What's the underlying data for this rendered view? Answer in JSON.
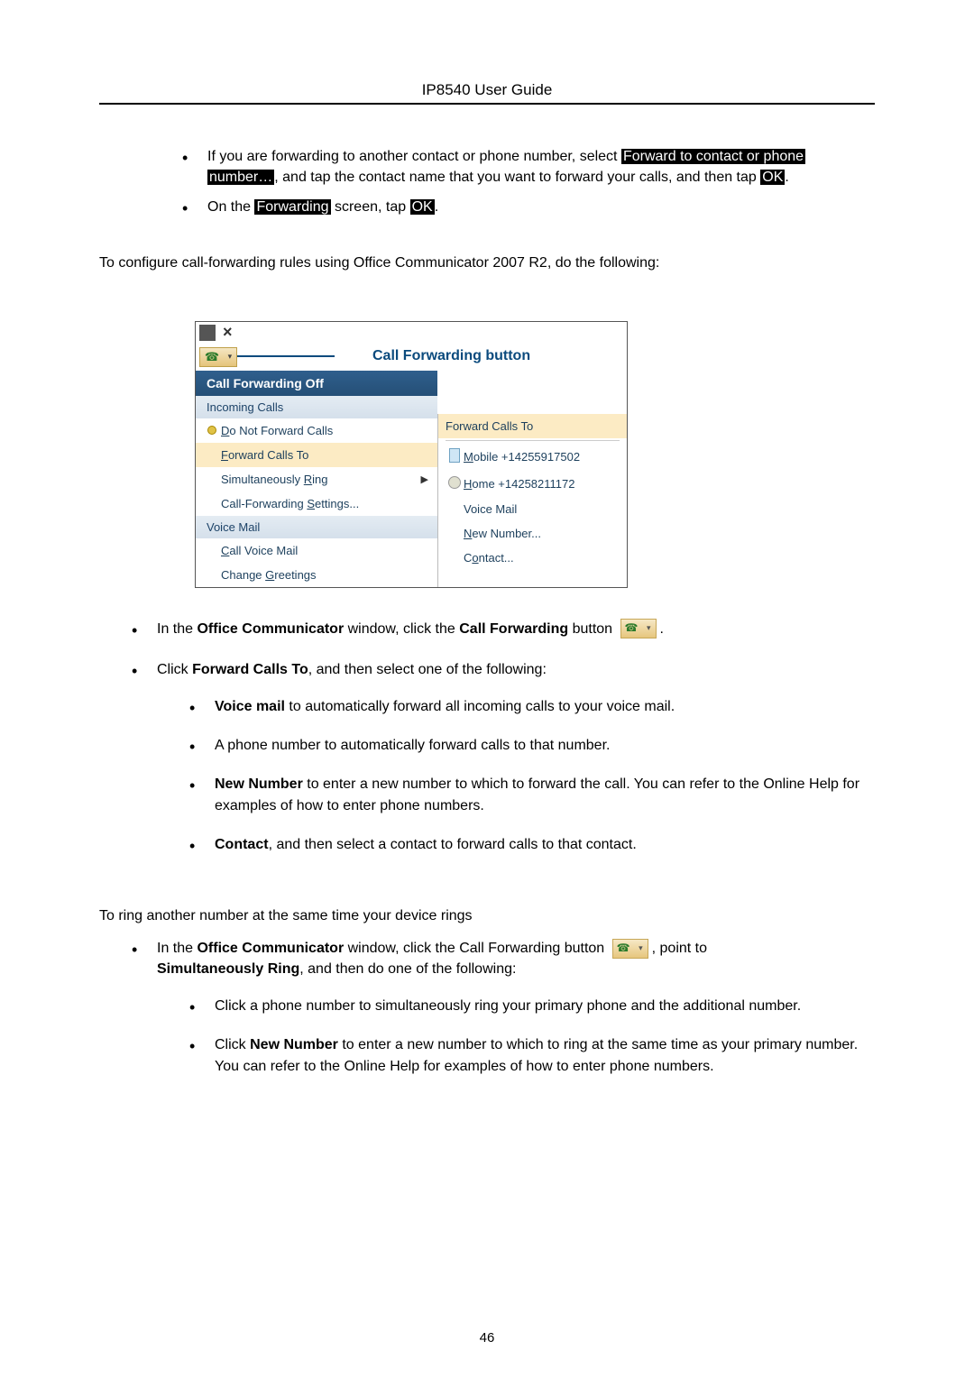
{
  "header": {
    "title": "IP8540 User Guide"
  },
  "bullets_top": [
    {
      "pre": "If you are forwarding to another contact or phone number, select ",
      "hl1": "Forward to contact or phone",
      "br": true,
      "hl1b": "number…",
      "mid": ", and tap the contact name that you want to forward your calls, and then tap ",
      "hl2": "OK",
      "suffix": "."
    },
    {
      "pre": "On the ",
      "hl1": "Forwarding",
      "mid": " screen, tap ",
      "hl2": "OK",
      "suffix": "."
    }
  ],
  "configure_line": "To configure call-forwarding rules using Office Communicator 2007 R2, do the following:",
  "menu": {
    "label": "Call Forwarding button",
    "left": {
      "header": "Call Forwarding Off",
      "section1": "Incoming Calls",
      "items1": [
        {
          "icon": "radio",
          "text": "Do Not Forward Calls",
          "u": "D"
        },
        {
          "text": "Forward Calls To",
          "u": "F",
          "selected": true
        },
        {
          "text": "Simultaneously Ring",
          "u": "R",
          "chev": true
        },
        {
          "text": "Call-Forwarding Settings...",
          "u": "S"
        }
      ],
      "section2": "Voice Mail",
      "items2": [
        {
          "text": "Call Voice Mail",
          "u": "C"
        },
        {
          "text": "Change Greetings",
          "u": "G"
        }
      ]
    },
    "right": {
      "header": "Forward Calls To",
      "items": [
        {
          "icon": "mobile",
          "text": "Mobile +14255917502",
          "u": "M"
        },
        {
          "icon": "home",
          "text": "Home +14258211172",
          "u": "H"
        },
        {
          "text": "Voice Mail"
        },
        {
          "text": "New Number...",
          "u": "N"
        },
        {
          "text": "Contact...",
          "u": "o",
          "uidx": 1
        }
      ]
    }
  },
  "mid_bullets": {
    "a": {
      "pre": "In the ",
      "b1": "Office Communicator",
      "mid": " window, click the ",
      "b2": "Call Forwarding",
      "suffix": " button ",
      "tail": "."
    },
    "b": {
      "pre": "Click ",
      "b1": "Forward Calls To",
      "suffix": ", and then select one of the following:"
    }
  },
  "sub_bullets": [
    {
      "b": "Voice mail",
      "rest": " to automatically forward all incoming calls to your voice mail."
    },
    {
      "rest": " A phone number to automatically forward calls to that number."
    },
    {
      "b": "New Number",
      "rest": " to enter a new number to which to forward the call. You can refer to the Online Help for examples of how to enter phone numbers."
    },
    {
      "b": "Contact",
      "rest": ", and then select a contact to forward calls to that contact."
    }
  ],
  "ring_line": "To ring another number at the same time your device rings",
  "ring_bullet": {
    "pre": "In the ",
    "b1": "Office Communicator",
    "mid": " window, click the Call Forwarding button ",
    "mid2": ", point to ",
    "b2": "Simultaneously Ring",
    "suffix": ", and then do one of the following:"
  },
  "ring_sub": [
    {
      "rest": "Click a phone number to simultaneously ring your primary phone and the additional number."
    },
    {
      "pre": "Click ",
      "b": "New Number",
      "rest": " to enter a new number to which to ring at the same time as your primary number. You can refer to the Online Help for examples of how to enter phone numbers."
    }
  ],
  "page_number": "46"
}
